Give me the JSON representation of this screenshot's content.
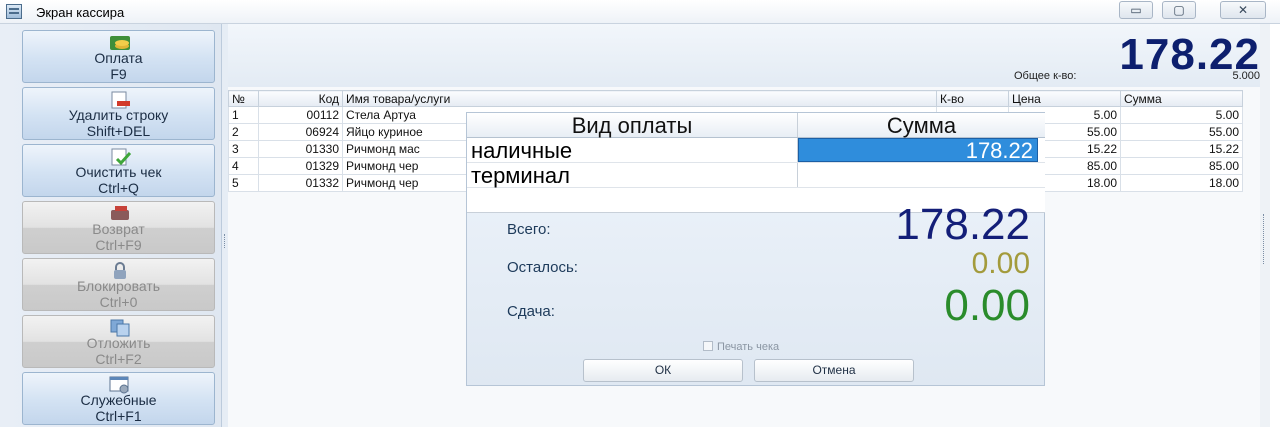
{
  "window": {
    "title": "Экран кассира",
    "min_glyph": "▭",
    "max_glyph": "▢",
    "close_glyph": "✕"
  },
  "left_buttons": [
    {
      "label": "Оплата",
      "shortcut": "F9",
      "icon": "coins-icon",
      "enabled": true
    },
    {
      "label": "Удалить строку",
      "shortcut": "Shift+DEL",
      "icon": "delete-row-icon",
      "enabled": true
    },
    {
      "label": "Очистить чек",
      "shortcut": "Ctrl+Q",
      "icon": "clear-receipt-icon",
      "enabled": true
    },
    {
      "label": "Возврат",
      "shortcut": "Ctrl+F9",
      "icon": "return-icon",
      "enabled": false
    },
    {
      "label": "Блокировать",
      "shortcut": "Ctrl+0",
      "icon": "lock-icon",
      "enabled": false
    },
    {
      "label": "Отложить",
      "shortcut": "Ctrl+F2",
      "icon": "postpone-icon",
      "enabled": false
    },
    {
      "label": "Служебные",
      "shortcut": "Ctrl+F1",
      "icon": "service-icon",
      "enabled": true
    }
  ],
  "totals": {
    "amount": "178.22",
    "qty_label": "Общее к-во:",
    "qty": "5.000"
  },
  "grid": {
    "columns": [
      "№",
      "Код",
      "Имя товара/услуги",
      "К-во",
      "Цена",
      "Сумма"
    ],
    "rows": [
      {
        "n": "1",
        "code": "00112",
        "name": "Стела Артуа",
        "qty": "",
        "price": "5.00",
        "sum": "5.00"
      },
      {
        "n": "2",
        "code": "06924",
        "name": "Яйцо куриное",
        "qty": "",
        "price": "55.00",
        "sum": "55.00"
      },
      {
        "n": "3",
        "code": "01330",
        "name": "Ричмонд мас",
        "qty": "",
        "price": "15.22",
        "sum": "15.22"
      },
      {
        "n": "4",
        "code": "01329",
        "name": "Ричмонд чер",
        "qty": "",
        "price": "85.00",
        "sum": "85.00"
      },
      {
        "n": "5",
        "code": "01332",
        "name": "Ричмонд чер",
        "qty": "",
        "price": "18.00",
        "sum": "18.00"
      }
    ]
  },
  "payment_dialog": {
    "col_type": "Вид оплаты",
    "col_amount": "Сумма",
    "methods": [
      {
        "name": "наличные",
        "amount": "178.22"
      },
      {
        "name": "терминал",
        "amount": ""
      }
    ],
    "total_label": "Всего:",
    "total_value": "178.22",
    "remaining_label": "Осталось:",
    "remaining_value": "0.00",
    "change_label": "Сдача:",
    "change_value": "0.00",
    "print_label": "Печать чека",
    "print_checked": false,
    "ok_label": "ОК",
    "cancel_label": "Отмена",
    "colors": {
      "total": "#131e78",
      "remaining": "#a39b3c",
      "change": "#2a8c2b",
      "selected_cell": "#2f8ddc"
    }
  }
}
